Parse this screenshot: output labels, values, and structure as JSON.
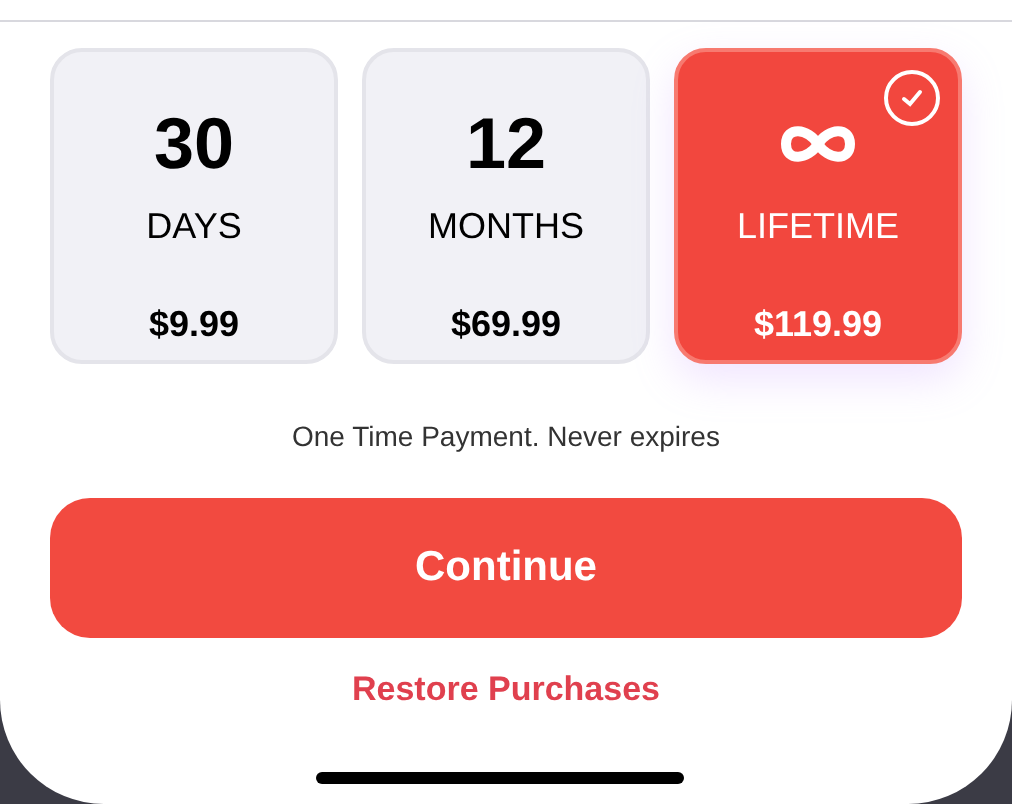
{
  "plans": [
    {
      "kind": "number",
      "value": "30",
      "unit": "DAYS",
      "price": "$9.99",
      "selected": false
    },
    {
      "kind": "number",
      "value": "12",
      "unit": "MONTHS",
      "price": "$69.99",
      "selected": false
    },
    {
      "kind": "infinity",
      "unit": "LIFETIME",
      "price": "$119.99",
      "selected": true
    }
  ],
  "note": "One Time Payment. Never expires",
  "continue_button": "Continue",
  "restore_link": "Restore Purchases"
}
